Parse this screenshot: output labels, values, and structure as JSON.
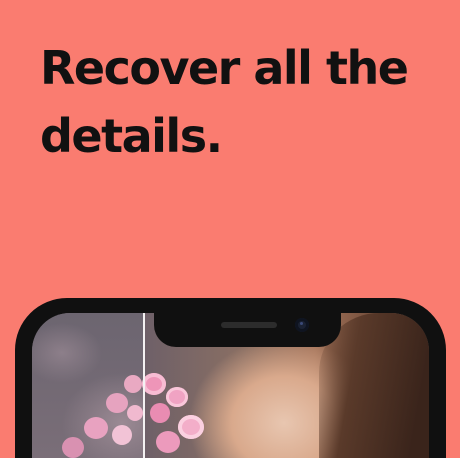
{
  "headline": "Recover all the details.",
  "colors": {
    "background": "#FA7C70",
    "text": "#111111",
    "device_frame": "#101010"
  },
  "preview": {
    "device": "smartphone",
    "subject": "portrait photo with pink flowers, before/after comparison"
  }
}
